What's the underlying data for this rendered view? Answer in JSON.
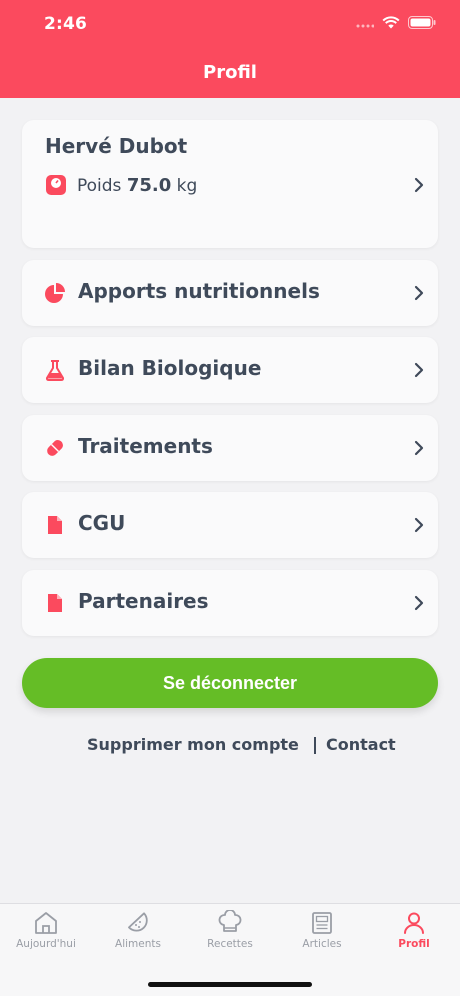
{
  "status_bar": {
    "time": "2:46"
  },
  "header": {
    "title": "Profil"
  },
  "profile": {
    "name": "Hervé Dubot",
    "weight_label": "Poids",
    "weight_value": "75.0",
    "weight_unit": "kg"
  },
  "menu": [
    {
      "label": "Apports nutritionnels",
      "icon": "pie-chart-icon"
    },
    {
      "label": "Bilan Biologique",
      "icon": "flask-icon"
    },
    {
      "label": "Traitements",
      "icon": "pill-icon"
    },
    {
      "label": "CGU",
      "icon": "document-icon"
    },
    {
      "label": "Partenaires",
      "icon": "document-icon"
    }
  ],
  "logout_label": "Se déconnecter",
  "footer_links": {
    "delete_account": "Supprimer mon compte",
    "contact": "Contact"
  },
  "tabs": [
    {
      "label": "Aujourd'hui",
      "icon": "home-icon"
    },
    {
      "label": "Aliments",
      "icon": "watermelon-icon"
    },
    {
      "label": "Recettes",
      "icon": "chef-hat-icon"
    },
    {
      "label": "Articles",
      "icon": "newspaper-icon"
    },
    {
      "label": "Profil",
      "icon": "user-icon",
      "active": true
    }
  ],
  "colors": {
    "brand": "#fb4a5e",
    "logout": "#65bd26",
    "text": "#3f4a5a",
    "tab_inactive": "#9a9ea6"
  }
}
